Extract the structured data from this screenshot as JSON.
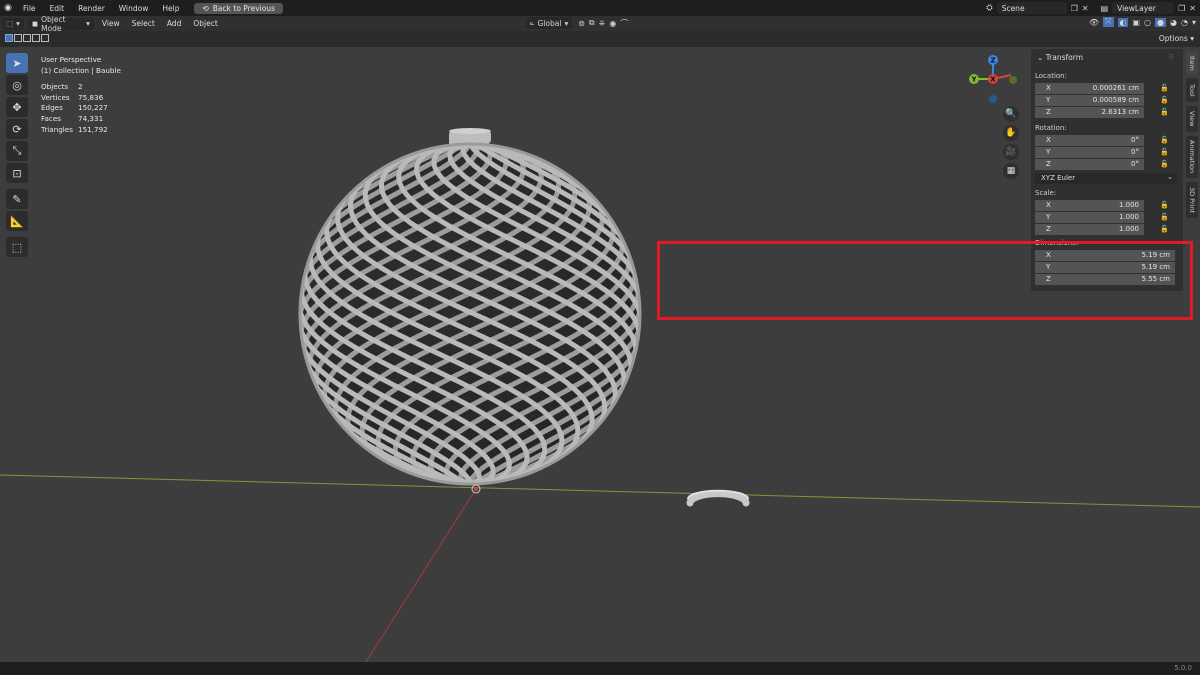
{
  "topbar": {
    "menus": [
      "File",
      "Edit",
      "Render",
      "Window",
      "Help"
    ],
    "back_button": "Back to Previous",
    "scene": "Scene",
    "view_layer": "ViewLayer"
  },
  "header": {
    "mode": "Object Mode",
    "menus": [
      "View",
      "Select",
      "Add",
      "Object"
    ],
    "orientation": "Global",
    "options": "Options"
  },
  "overlay": {
    "perspective": "User Perspective",
    "collection": "(1) Collection | Bauble",
    "stats": [
      {
        "k": "Objects",
        "v": "2"
      },
      {
        "k": "Vertices",
        "v": "75,836"
      },
      {
        "k": "Edges",
        "v": "150,227"
      },
      {
        "k": "Faces",
        "v": "74,331"
      },
      {
        "k": "Triangles",
        "v": "151,792"
      }
    ]
  },
  "gizmo": {
    "x": "X",
    "y": "Y",
    "z": "Z"
  },
  "npanel": {
    "title": "Transform",
    "location_label": "Location:",
    "location": [
      {
        "axis": "X",
        "value": "0.000261 cm"
      },
      {
        "axis": "Y",
        "value": "0.000589 cm"
      },
      {
        "axis": "Z",
        "value": "2.6313 cm"
      }
    ],
    "rotation_label": "Rotation:",
    "rotation": [
      {
        "axis": "X",
        "value": "0°"
      },
      {
        "axis": "Y",
        "value": "0°"
      },
      {
        "axis": "Z",
        "value": "0°"
      }
    ],
    "rotation_mode": "XYZ Euler",
    "scale_label": "Scale:",
    "scale": [
      {
        "axis": "X",
        "value": "1.000"
      },
      {
        "axis": "Y",
        "value": "1.000"
      },
      {
        "axis": "Z",
        "value": "1.000"
      }
    ],
    "dimensions_label": "Dimensions:",
    "dimensions": [
      {
        "axis": "X",
        "value": "5.19 cm"
      },
      {
        "axis": "Y",
        "value": "5.19 cm"
      },
      {
        "axis": "Z",
        "value": "5.55 cm"
      }
    ]
  },
  "tabs": [
    "Item",
    "Tool",
    "View",
    "Animation",
    "3D Print"
  ],
  "status": {
    "version": "5.0.0"
  },
  "colors": {
    "accent": "#4772b3",
    "highlight": "#e01b24",
    "x_axis": "#d64343",
    "y_axis": "#86b833",
    "z_axis": "#3f84e5"
  }
}
